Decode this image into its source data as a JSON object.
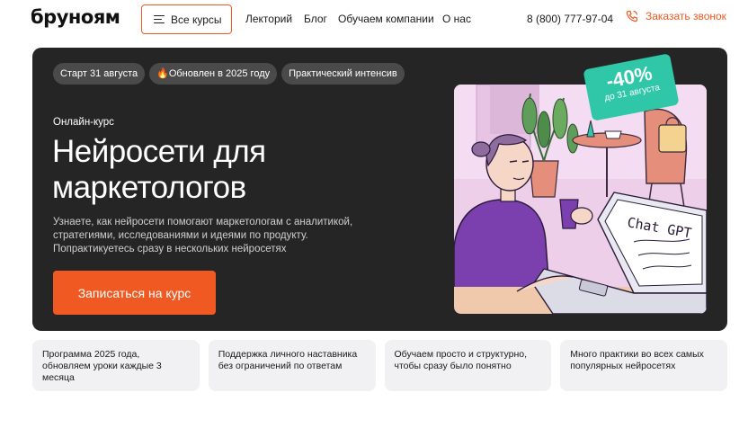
{
  "header": {
    "logo": "бруноям",
    "all_courses": "Все курсы",
    "nav": [
      "Лекторий",
      "Блог",
      "Обучаем компании",
      "О нас"
    ],
    "phone": "8 (800) 777-97-04",
    "callback": "Заказать звонок"
  },
  "hero": {
    "tags": [
      "Старт 31 августа",
      "🔥Обновлен в 2025 году",
      "Практический интенсив"
    ],
    "kicker": "Онлайн-курс",
    "title_line1": "Нейросети для",
    "title_line2": "маркетологов",
    "description": "Узнаете, как нейросети помогают маркетологам с аналитикой, стратегиями, исследованиями и идеями по продукту. Попрактикуетесь сразу в нескольких нейросетях",
    "cta": "Записаться на курс",
    "badge": {
      "discount": "-40%",
      "until": "до 31 августа"
    },
    "illustration_text": "Chat GPT"
  },
  "features": [
    "Программа 2025 года, обновляем уроки каждые 3 месяца",
    "Поддержка личного наставника без ограничений по ответам",
    "Обучаем просто и структурно, чтобы сразу было понятно",
    "Много практики во всех самых популярных нейросетях"
  ],
  "colors": {
    "accent": "#f05a22",
    "hero_bg": "#252525",
    "badge": "#2fc7a8",
    "illustration_bg": "#f4dcf2"
  }
}
